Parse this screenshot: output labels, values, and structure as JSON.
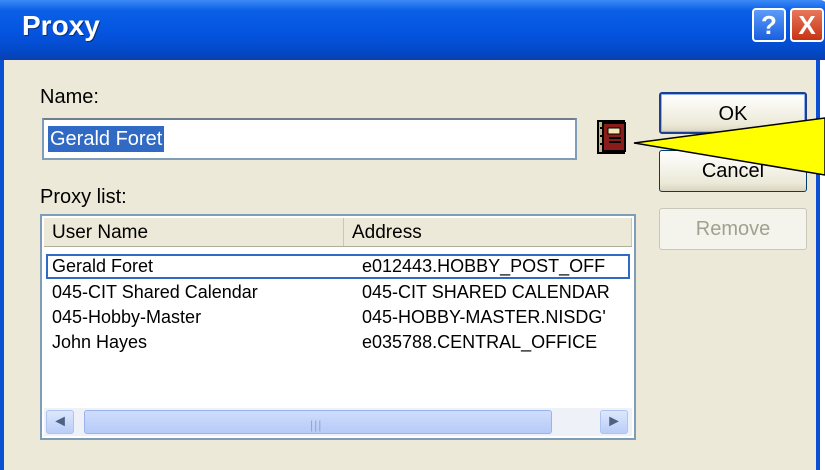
{
  "window": {
    "title": "Proxy"
  },
  "name_field": {
    "label": "Name:",
    "value": "Gerald Foret"
  },
  "proxy_list": {
    "label": "Proxy list:",
    "columns": [
      "User Name",
      "Address"
    ],
    "rows": [
      {
        "user": "Gerald Foret",
        "address": "e012443.HOBBY_POST_OFF",
        "selected": true
      },
      {
        "user": "045-CIT Shared Calendar",
        "address": "045-CIT SHARED CALENDAR",
        "selected": false
      },
      {
        "user": "045-Hobby-Master",
        "address": "045-HOBBY-MASTER.NISDG'",
        "selected": false
      },
      {
        "user": "John Hayes",
        "address": "e035788.CENTRAL_OFFICE",
        "selected": false
      }
    ]
  },
  "buttons": {
    "ok": "OK",
    "cancel": "Cancel",
    "remove": "Remove"
  },
  "titlebar_buttons": {
    "help": "?",
    "close": "X"
  },
  "icons": {
    "address_book": "address-book-icon",
    "scroll_left": "◄",
    "scroll_right": "►",
    "grip": "|||"
  },
  "colors": {
    "titlebar": "#0454e0",
    "selection": "#316ac5",
    "callout": "#ffff00"
  }
}
